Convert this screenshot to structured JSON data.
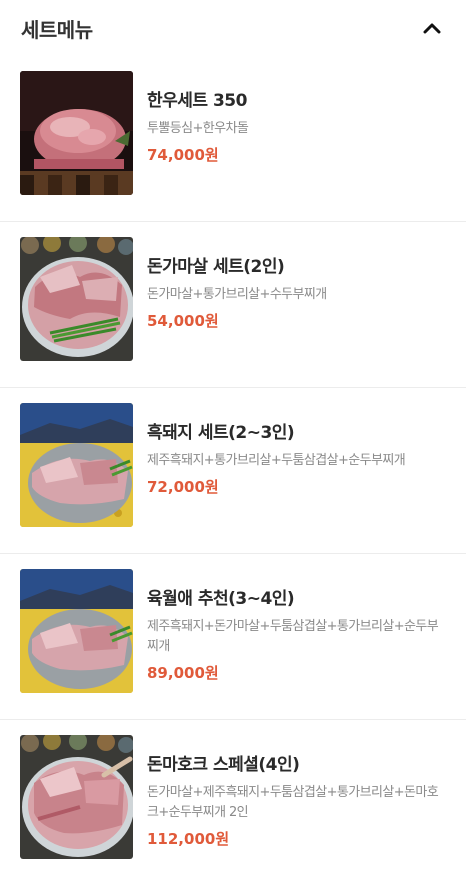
{
  "section": {
    "title": "세트메뉴"
  },
  "menu": {
    "items": [
      {
        "name": "한우세트 350",
        "desc": "투뿔등심+한우차돌",
        "price": "74,000원",
        "image": "hanwoo-steak"
      },
      {
        "name": "돈가마살 세트(2인)",
        "desc": "돈가마살+통가브리살+수두부찌개",
        "price": "54,000원",
        "image": "pork-platter"
      },
      {
        "name": "흑돼지 세트(2~3인)",
        "desc": "제주흑돼지+통가브리살+두툼삼겹살+순두부찌개",
        "price": "72,000원",
        "image": "jeju-blackpork"
      },
      {
        "name": "육월애 추천(3~4인)",
        "desc": "제주흑돼지+돈가마살+두툼삼겹살+통가브리살+순두부찌개",
        "price": "89,000원",
        "image": "jeju-blackpork"
      },
      {
        "name": "돈마호크 스페셜(4인)",
        "desc": "돈가마살+제주흑돼지+두툼삼겹살+통가브리살+돈마호크+순두부찌개 2인",
        "price": "112,000원",
        "image": "tomahawk-platter"
      }
    ]
  },
  "icons": {
    "collapse": "chevron-up-icon"
  },
  "colors": {
    "price": "#e05a3a",
    "title": "#333333",
    "description": "#8a8a8a",
    "divider": "#ececec"
  }
}
